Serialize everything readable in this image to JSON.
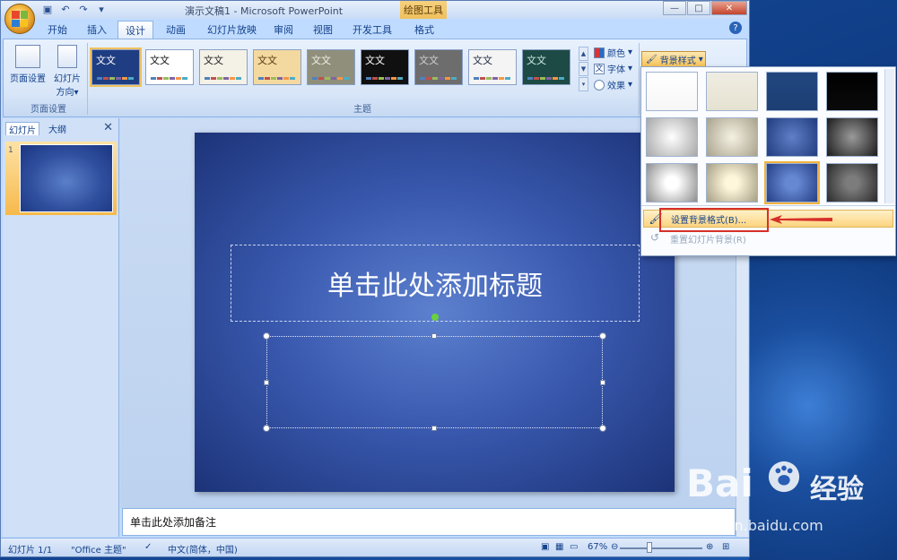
{
  "app": {
    "window_title": "演示文稿1 - Microsoft PowerPoint",
    "contextual_tab": "绘图工具"
  },
  "tabs": [
    {
      "label": "开始",
      "active": false
    },
    {
      "label": "插入",
      "active": false
    },
    {
      "label": "设计",
      "active": true
    },
    {
      "label": "动画",
      "active": false
    },
    {
      "label": "幻灯片放映",
      "active": false
    },
    {
      "label": "审阅",
      "active": false
    },
    {
      "label": "视图",
      "active": false
    },
    {
      "label": "开发工具",
      "active": false
    },
    {
      "label": "格式",
      "active": false
    }
  ],
  "ribbon": {
    "page_setup_label": "页面设置",
    "orientation_label": "幻灯片",
    "orientation_label2": "方向",
    "group_page_setup": "页面设置",
    "group_themes": "主题",
    "theme_text": "文文",
    "colors_label": "颜色",
    "fonts_label": "字体",
    "effects_label": "效果",
    "background_styles_label": "背景样式"
  },
  "themes": [
    {
      "bg": "#1f3d82",
      "fg": "#ffffff",
      "selected": true
    },
    {
      "bg": "#ffffff",
      "fg": "#111111",
      "selected": false
    },
    {
      "bg": "#f4f1e6",
      "fg": "#222222",
      "selected": false
    },
    {
      "bg": "#f3d9a0",
      "fg": "#5a3a10",
      "selected": false
    },
    {
      "bg": "#8f8f7c",
      "fg": "#f2f2e6",
      "selected": false
    },
    {
      "bg": "#101010",
      "fg": "#ffffff",
      "selected": false
    },
    {
      "bg": "#6d6d6d",
      "fg": "#cfcfcf",
      "selected": false
    },
    {
      "bg": "#f4f4f4",
      "fg": "#1f2a44",
      "selected": false
    },
    {
      "bg": "#1d4a44",
      "fg": "#cfe8e2",
      "selected": false
    }
  ],
  "left_panel": {
    "tab_slides": "幻灯片",
    "tab_outline": "大纲",
    "slide_number": "1"
  },
  "slide": {
    "title_placeholder": "单击此处添加标题"
  },
  "notes": {
    "placeholder": "单击此处添加备注"
  },
  "status": {
    "slide_info": "幻灯片 1/1",
    "theme_name": "\"Office 主题\"",
    "language": "中文(简体，中国)",
    "zoom": "67%"
  },
  "background_menu": {
    "swatches": [
      "linear-gradient(#ffffff,#f6f6f6)",
      "linear-gradient(#efede2,#e6e2d2)",
      "linear-gradient(#21477f,#1c3e74)",
      "linear-gradient(#000000,#0a0a0a)",
      "radial-gradient(circle,#ffffff 0%,#a7a7a7 100%)",
      "radial-gradient(circle,#f6f2e3 0%,#a8a28c 100%)",
      "radial-gradient(circle,#5f7fc7 0%,#223c7f 100%)",
      "radial-gradient(circle,#9a9a9a 0%,#1b1b1b 100%)",
      "radial-gradient(circle,#ffffff 20%,#8d8d8d 100%)",
      "radial-gradient(circle,#fff7dc 20%,#a59e84 100%)",
      "radial-gradient(circle,#6688d2 20%,#243f86 100%)",
      "radial-gradient(circle,#7c7c7c 20%,#2a2a2a 100%)"
    ],
    "selected_index": 10,
    "format_background": "设置背景格式(B)...",
    "reset_background": "重置幻灯片背景(R)"
  },
  "watermark": {
    "logo": "Bai",
    "jingyan": "经验",
    "url": "jingyan.baidu.com"
  },
  "colors": {
    "accent_red": "#d6302a",
    "slide_bg": "#3a5ab0"
  }
}
